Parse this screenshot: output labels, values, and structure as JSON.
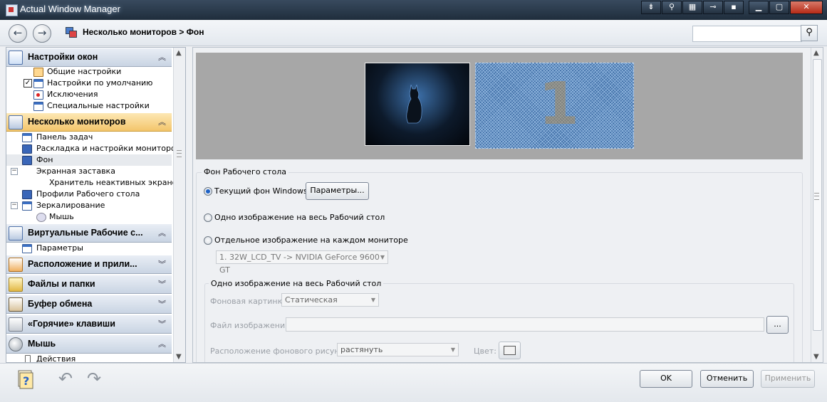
{
  "window": {
    "title": "Actual Window Manager"
  },
  "titlebar_buttons": [
    "pin-icon",
    "tools-icon",
    "transparency-icon",
    "pushpin-icon",
    "minimize-to-tray-icon",
    "minimize-icon",
    "maximize-icon",
    "close-icon"
  ],
  "toolbar": {
    "breadcrumb": "Несколько мониторов > Фон",
    "search_value": "",
    "search_placeholder": ""
  },
  "sidebar": {
    "sections": [
      {
        "label": "Настройки окон",
        "state": "expanded",
        "items": [
          "Общие настройки",
          "Настройки по умолчанию",
          "Исключения",
          "Специальные настройки"
        ]
      },
      {
        "label": "Несколько мониторов",
        "state": "expanded",
        "active": true,
        "items": [
          "Панель задач",
          "Раскладка и настройки мониторов",
          "Фон",
          "Экранная заставка",
          "Хранитель неактивных экранов",
          "Профили Рабочего стола",
          "Зеркалирование",
          "Мышь"
        ]
      },
      {
        "label": "Виртуальные Рабочие с...",
        "state": "expanded",
        "items": [
          "Параметры"
        ]
      },
      {
        "label": "Расположение и прили...",
        "state": "collapsed"
      },
      {
        "label": "Файлы и папки",
        "state": "collapsed"
      },
      {
        "label": "Буфер обмена",
        "state": "collapsed"
      },
      {
        "label": "«Горячие» клавиши",
        "state": "collapsed"
      },
      {
        "label": "Мышь",
        "state": "expanded",
        "items": [
          "Действия"
        ]
      }
    ],
    "selected_item": "Фон",
    "checked_item": "Настройки по умолчанию"
  },
  "preview": {
    "monitor2_number": "1"
  },
  "desktop_bg": {
    "group_title": "Фон Рабочего стола",
    "options": [
      {
        "label": "Текущий фон Windows",
        "selected": true
      },
      {
        "label": "Одно изображение на весь Рабочий стол",
        "selected": false
      },
      {
        "label": "Отдельное изображение на каждом мониторе",
        "selected": false
      }
    ],
    "params_button": "Параметры...",
    "monitor_select": "1. 32W_LCD_TV -> NVIDIA GeForce 9600 GT"
  },
  "single_image": {
    "group_title": "Одно изображение на весь Рабочий стол",
    "bg_picture_label": "Фоновая картинка",
    "bg_picture_value": "Статическая",
    "file_label": "Файл изображения:",
    "file_value": "",
    "browse_button": "...",
    "position_label": "Расположение фонового рисунка:",
    "position_value": "растянуть",
    "color_label": "Цвет:"
  },
  "footer": {
    "ok": "OK",
    "cancel": "Отменить",
    "apply": "Применить"
  },
  "colors": {
    "title_bar": "#1f2d3c",
    "active_section": "#f3c56b",
    "radio_selected": "#1e62c6",
    "close_button": "#b52a16"
  }
}
